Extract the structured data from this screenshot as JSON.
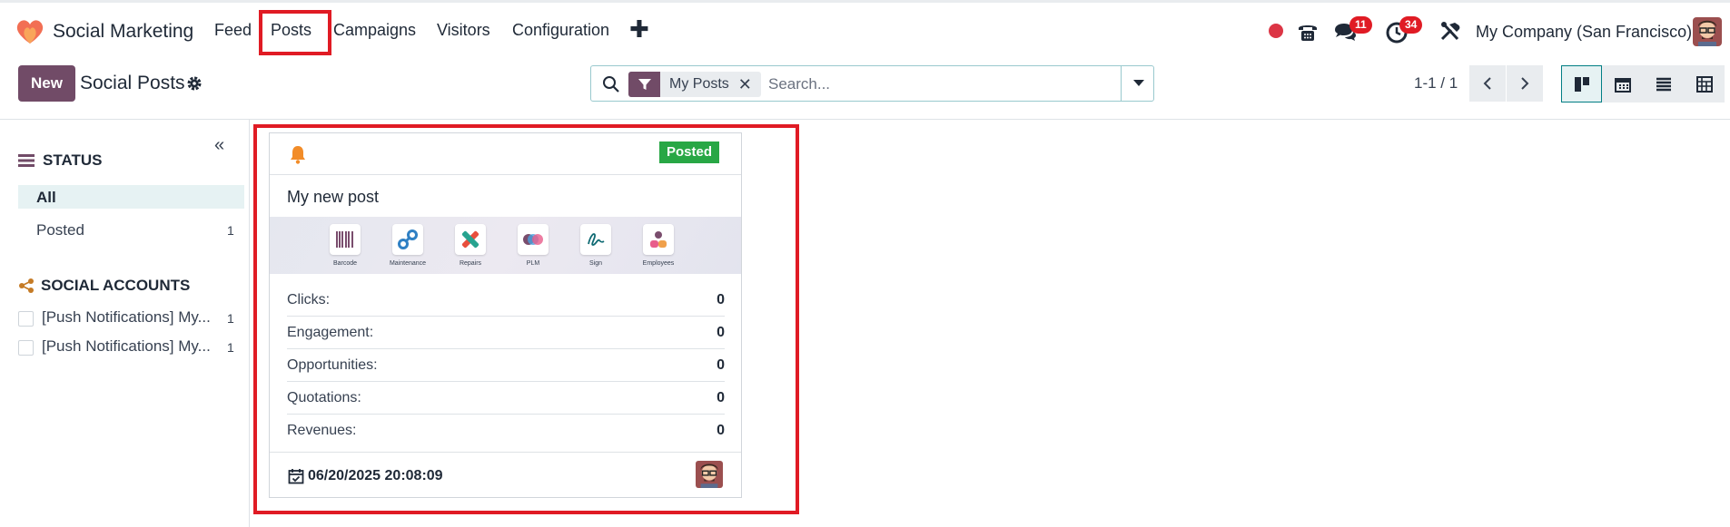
{
  "app": {
    "name": "Social Marketing",
    "logo_icon": "heart-logo-icon",
    "accent": "#714b67"
  },
  "nav": {
    "items": [
      {
        "label": "Feed"
      },
      {
        "label": "Posts"
      },
      {
        "label": "Campaigns"
      },
      {
        "label": "Visitors"
      },
      {
        "label": "Configuration"
      }
    ],
    "plus": "✚",
    "highlighted": "Posts"
  },
  "systray": {
    "messages_count": "11",
    "activities_count": "34",
    "company": "My Company (San Francisco)"
  },
  "control_panel": {
    "new_label": "New",
    "title": "Social Posts",
    "search": {
      "facet_label": "My Posts",
      "facet_remove": "✕",
      "placeholder": "Search..."
    },
    "pager": "1-1 / 1",
    "views": [
      "kanban",
      "calendar",
      "list",
      "pivot"
    ],
    "active_view": "kanban"
  },
  "sidebar": {
    "collapse": "«",
    "status": {
      "title": "STATUS",
      "items": [
        {
          "label": "All",
          "count": ""
        },
        {
          "label": "Posted",
          "count": "1"
        }
      ]
    },
    "accounts": {
      "title": "SOCIAL ACCOUNTS",
      "items": [
        {
          "label": "[Push Notifications] My...",
          "count": "1"
        },
        {
          "label": "[Push Notifications] My...",
          "count": "1"
        }
      ]
    }
  },
  "card": {
    "status_badge": "Posted",
    "message": "My new post",
    "banner_apps": [
      {
        "name": "Barcode"
      },
      {
        "name": "Maintenance"
      },
      {
        "name": "Repairs"
      },
      {
        "name": "PLM"
      },
      {
        "name": "Sign"
      },
      {
        "name": "Employees"
      }
    ],
    "stats": [
      {
        "label": "Clicks:",
        "value": "0"
      },
      {
        "label": "Engagement:",
        "value": "0"
      },
      {
        "label": "Opportunities:",
        "value": "0"
      },
      {
        "label": "Quotations:",
        "value": "0"
      },
      {
        "label": "Revenues:",
        "value": "0"
      }
    ],
    "date": "06/20/2025 20:08:09"
  }
}
